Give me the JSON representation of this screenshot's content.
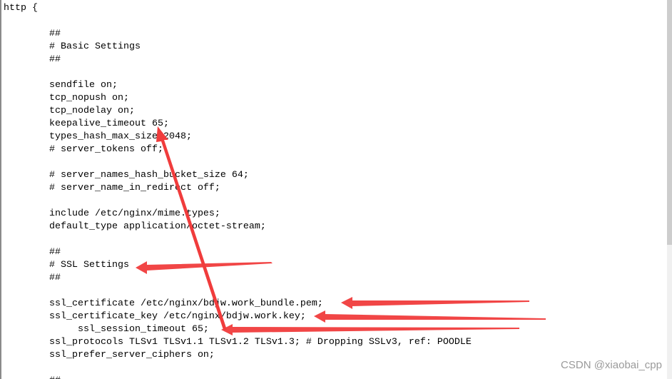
{
  "code_lines": [
    "http {",
    "",
    "        ##",
    "        # Basic Settings",
    "        ##",
    "",
    "        sendfile on;",
    "        tcp_nopush on;",
    "        tcp_nodelay on;",
    "        keepalive_timeout 65;",
    "        types_hash_max_size 2048;",
    "        # server_tokens off;",
    "",
    "        # server_names_hash_bucket_size 64;",
    "        # server_name_in_redirect off;",
    "",
    "        include /etc/nginx/mime.types;",
    "        default_type application/octet-stream;",
    "",
    "        ##",
    "        # SSL Settings",
    "        ##",
    "",
    "        ssl_certificate /etc/nginx/bdjw.work_bundle.pem;",
    "        ssl_certificate_key /etc/nginx/bdjw.work.key;",
    "             ssl_session_timeout 65;",
    "        ssl_protocols TLSv1 TLSv1.1 TLSv1.2 TLSv1.3; # Dropping SSLv3, ref: POODLE",
    "        ssl_prefer_server_ciphers on;",
    "",
    "        ##"
  ],
  "watermark": "CSDN @xiaobai_cpp",
  "colors": {
    "annotation_arrow": "#f03c3c",
    "scrollbar_thumb": "#cdcdcd",
    "scrollbar_track": "#f0f0f0"
  },
  "scroll_position_percent": 0
}
